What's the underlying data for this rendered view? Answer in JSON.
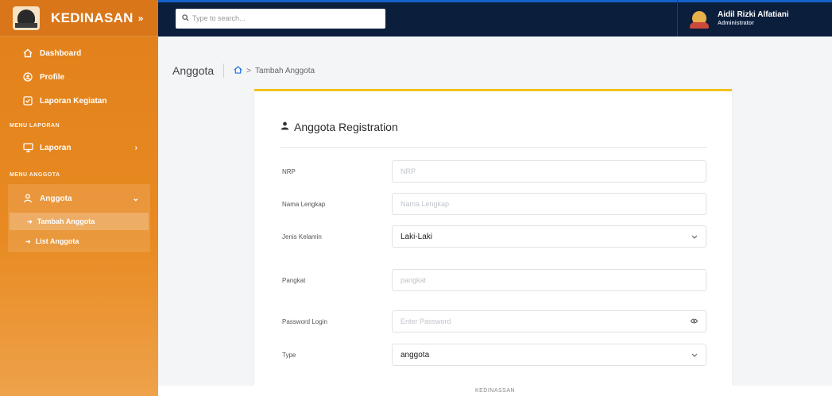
{
  "brand": {
    "name": "KEDINASAN",
    "toggle": "»"
  },
  "sidebar": {
    "items": [
      {
        "label": "Dashboard",
        "icon": "home-icon"
      },
      {
        "label": "Profile",
        "icon": "user-circle-icon"
      },
      {
        "label": "Laporan Kegiatan",
        "icon": "check-square-icon"
      }
    ],
    "section_laporan": "MENU LAPORAN",
    "laporan": {
      "label": "Laporan",
      "icon": "monitor-icon"
    },
    "section_anggota": "MENU ANGGOTA",
    "anggota": {
      "label": "Anggota",
      "icon": "person-icon",
      "children": [
        {
          "label": "Tambah Anggota"
        },
        {
          "label": "List Anggota"
        }
      ]
    }
  },
  "topbar": {
    "search_placeholder": "Type to search...",
    "user_name": "Aidil Rizki Alfatiani",
    "user_role": "Administrator"
  },
  "breadcrumb": {
    "section": "Anggota",
    "current": "Tambah Anggota"
  },
  "form": {
    "title": "Anggota Registration",
    "fields": [
      {
        "label": "NRP",
        "placeholder": "NRP"
      },
      {
        "label": "Nama Lengkap",
        "placeholder": "Nama Lengkap"
      },
      {
        "label": "Jenis Kelamin",
        "value": "Laki-Laki"
      },
      {
        "label": "Pangkat",
        "placeholder": "pangkat"
      },
      {
        "label": "Password Login",
        "placeholder": "Enter Password"
      },
      {
        "label": "Type",
        "value": "anggota"
      }
    ]
  },
  "footer": {
    "text": "KEDINASSAN"
  },
  "colors": {
    "sidebar": "#e2801a",
    "topbar": "#0b1e3c",
    "card_accent": "#f2c21d"
  }
}
